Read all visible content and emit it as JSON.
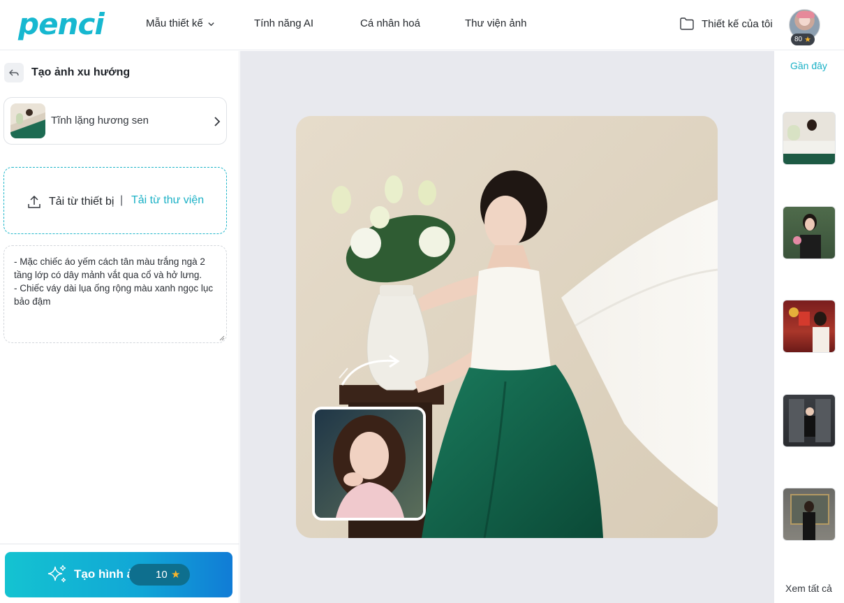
{
  "header": {
    "logo": "penci",
    "nav": [
      {
        "label": "Mẫu thiết kế",
        "has_dropdown": true
      },
      {
        "label": "Tính năng AI"
      },
      {
        "label": "Cá nhân hoá"
      },
      {
        "label": "Thư viện ảnh"
      }
    ],
    "my_designs": "Thiết kế của tôi",
    "user_points": "80"
  },
  "left_panel": {
    "title": "Tạo ảnh xu hướng",
    "style_card": {
      "name": "Tĩnh lặng hương sen"
    },
    "upload": {
      "device_label": "Tải từ thiết bị",
      "separator": "|",
      "library_label": "Tải từ thư viện"
    },
    "prompt_text": "- Mặc chiếc áo yếm cách tân màu trắng ngà 2 tầng lớp có dây mảnh vắt qua cổ và hở lưng.\n- Chiếc váy dài lụa ống rộng màu xanh ngọc lục bảo đậm",
    "generate_button": {
      "label": "Tạo hình ảnh",
      "cost": "10"
    }
  },
  "right_panel": {
    "title": "Gần đây",
    "view_all": "Xem tất cả",
    "recent_count": 5
  },
  "colors": {
    "brand": "#17b8d0",
    "accent_link": "#1bb1c6",
    "button_gradient_start": "#14c3d1",
    "button_gradient_end": "#117cd6",
    "canvas_bg": "#e8e9ee",
    "dress_green": "#0f5a45"
  },
  "icons": [
    "chevron-down-icon",
    "folder-icon",
    "star-icon",
    "back-icon",
    "chevron-right-icon",
    "upload-icon",
    "sparkle-icon",
    "swap-arrow-icon"
  ]
}
